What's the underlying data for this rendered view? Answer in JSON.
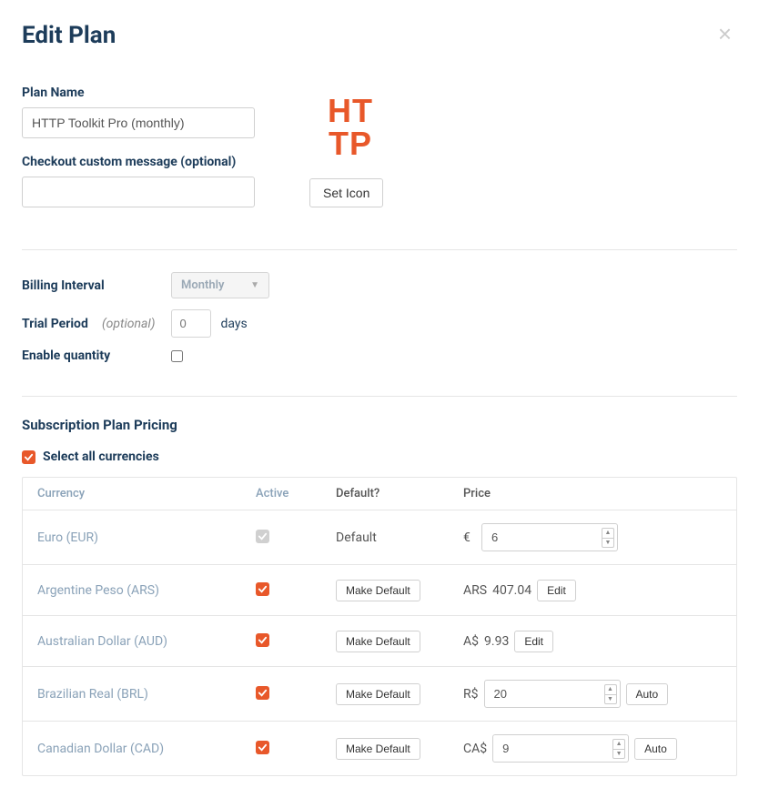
{
  "modal": {
    "title": "Edit Plan",
    "close": "×"
  },
  "planName": {
    "label": "Plan Name",
    "value": "HTTP Toolkit Pro (monthly)"
  },
  "checkoutMessage": {
    "label": "Checkout custom message (optional)",
    "value": ""
  },
  "icon": {
    "setIconLabel": "Set Icon"
  },
  "billing": {
    "intervalLabel": "Billing Interval",
    "intervalValue": "Monthly",
    "trialLabel": "Trial Period",
    "optional": "(optional)",
    "trialValue": "0",
    "daysLabel": "days",
    "enableQuantityLabel": "Enable quantity"
  },
  "pricing": {
    "heading": "Subscription Plan Pricing",
    "selectAllLabel": "Select all currencies",
    "headers": {
      "currency": "Currency",
      "active": "Active",
      "default": "Default?",
      "price": "Price"
    },
    "defaultText": "Default",
    "makeDefault": "Make Default",
    "edit": "Edit",
    "auto": "Auto",
    "rows": [
      {
        "name": "Euro (EUR)",
        "symbol": "€",
        "value": "6"
      },
      {
        "name": "Argentine Peso (ARS)",
        "prefix": "ARS",
        "fixed": "407.04"
      },
      {
        "name": "Australian Dollar (AUD)",
        "prefix": "A$",
        "fixed": "9.93"
      },
      {
        "name": "Brazilian Real (BRL)",
        "prefix": "R$",
        "value": "20"
      },
      {
        "name": "Canadian Dollar (CAD)",
        "prefix": "CA$",
        "value": "9"
      }
    ]
  }
}
